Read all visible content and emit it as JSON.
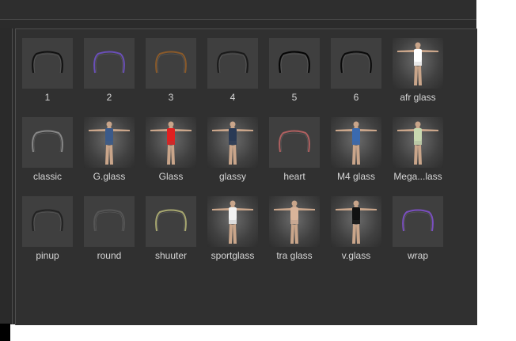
{
  "assets": [
    {
      "label": "1",
      "kind": "glasses",
      "tint": "#111111"
    },
    {
      "label": "2",
      "kind": "glasses",
      "tint": "#6a4fb8"
    },
    {
      "label": "3",
      "kind": "glasses",
      "tint": "#8a5a2a"
    },
    {
      "label": "4",
      "kind": "glasses",
      "tint": "#1a1a1a"
    },
    {
      "label": "5",
      "kind": "glasses",
      "tint": "#050505"
    },
    {
      "label": "6",
      "kind": "glasses",
      "tint": "#0a0a0a"
    },
    {
      "label": "afr glass",
      "kind": "figure",
      "tint": "#ffffff"
    },
    {
      "label": "classic",
      "kind": "glasses",
      "tint": "#888888"
    },
    {
      "label": "G.glass",
      "kind": "figure",
      "tint": "#3b5a8a"
    },
    {
      "label": "Glass",
      "kind": "figure",
      "tint": "#e02020"
    },
    {
      "label": "glassy",
      "kind": "figure",
      "tint": "#2a3a55"
    },
    {
      "label": "heart",
      "kind": "glasses",
      "tint": "#b06060"
    },
    {
      "label": "M4 glass",
      "kind": "figure",
      "tint": "#3a6ab0"
    },
    {
      "label": "Mega...lass",
      "kind": "figure",
      "tint": "#c8d8b0"
    },
    {
      "label": "pinup",
      "kind": "glasses",
      "tint": "#222222"
    },
    {
      "label": "round",
      "kind": "glasses",
      "tint": "#555555"
    },
    {
      "label": "shuuter",
      "kind": "glasses",
      "tint": "#a8a870"
    },
    {
      "label": "sportglass",
      "kind": "figure",
      "tint": "#f2f2f2"
    },
    {
      "label": "tra glass",
      "kind": "figure",
      "tint": "#d9b49a"
    },
    {
      "label": "v.glass",
      "kind": "figure",
      "tint": "#111111"
    },
    {
      "label": "wrap",
      "kind": "glasses",
      "tint": "#7a4fc0"
    }
  ]
}
